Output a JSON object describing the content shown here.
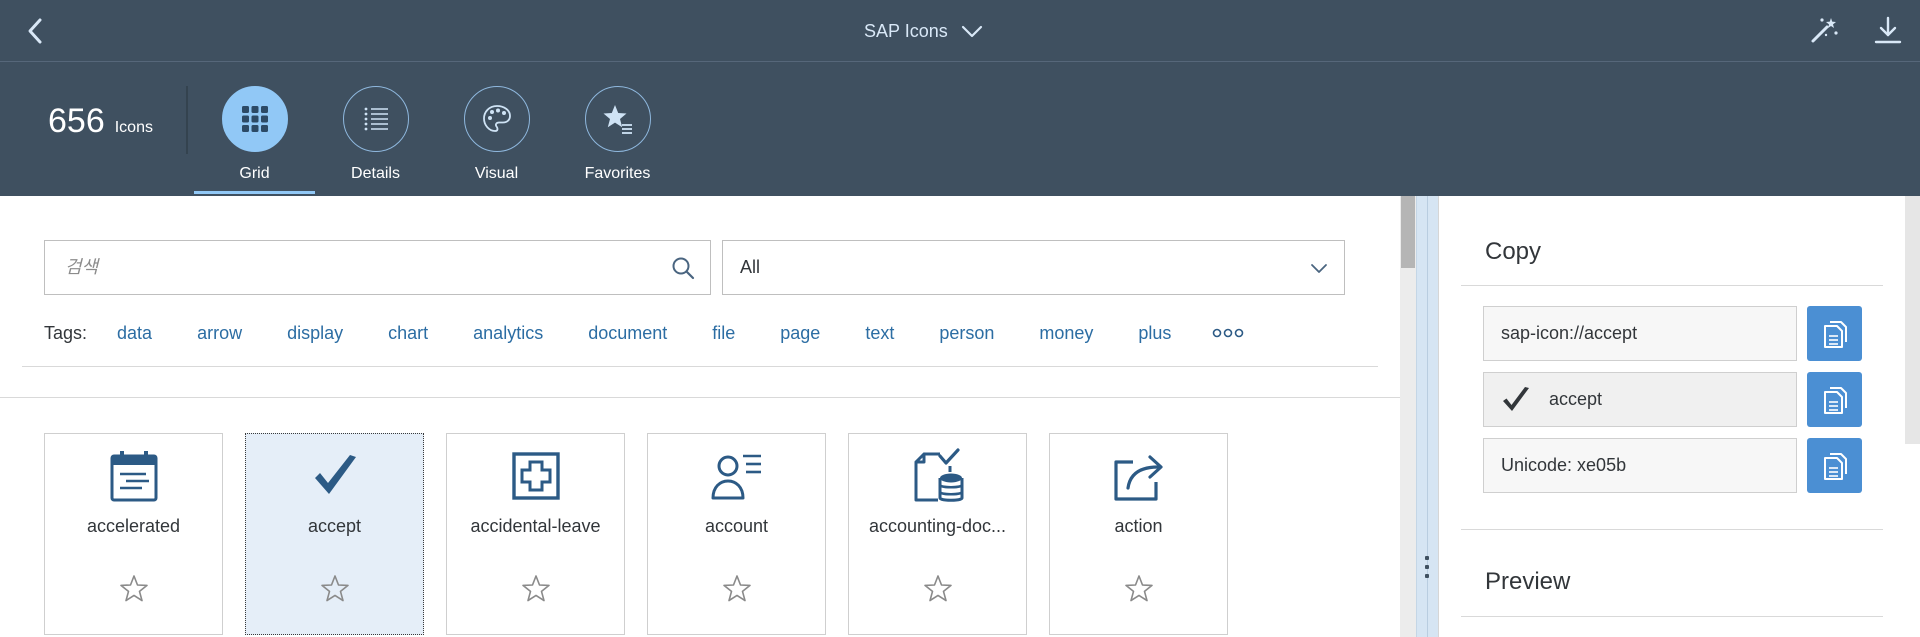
{
  "shell": {
    "title": "SAP Icons",
    "icons": {
      "back": "back-arrow-icon",
      "title_menu": "chevron-down-icon",
      "magic": "magic-wand-icon",
      "download": "download-icon"
    }
  },
  "header": {
    "count_value": "656",
    "count_label": "Icons",
    "tabs": [
      {
        "label": "Grid",
        "icon": "grid-icon",
        "active": true
      },
      {
        "label": "Details",
        "icon": "list-icon",
        "active": false
      },
      {
        "label": "Visual",
        "icon": "palette-icon",
        "active": false
      },
      {
        "label": "Favorites",
        "icon": "favorite-list-icon",
        "active": false
      }
    ]
  },
  "search": {
    "placeholder": "검색",
    "value": ""
  },
  "filter": {
    "selected": "All"
  },
  "tags": {
    "label": "Tags:",
    "items": [
      "data",
      "arrow",
      "display",
      "chart",
      "analytics",
      "document",
      "file",
      "page",
      "text",
      "person",
      "money",
      "plus"
    ]
  },
  "icons_list": [
    {
      "name": "accelerated",
      "icon": "calendar-accelerated-icon",
      "selected": false
    },
    {
      "name": "accept",
      "icon": "checkmark-icon",
      "selected": true
    },
    {
      "name": "accidental-leave",
      "icon": "medical-cross-icon",
      "selected": false
    },
    {
      "name": "account",
      "icon": "person-account-icon",
      "selected": false
    },
    {
      "name": "accounting-doc...",
      "icon": "accounting-document-icon",
      "selected": false
    },
    {
      "name": "action",
      "icon": "share-action-icon",
      "selected": false
    }
  ],
  "side": {
    "copy_title": "Copy",
    "copy_fields": {
      "uri": "sap-icon://accept",
      "glyph_name": "accept",
      "unicode": "Unicode: xe05b"
    },
    "preview_title": "Preview"
  },
  "colors": {
    "shell_bg": "#3f5060",
    "accent": "#91c8f6",
    "icon_blue": "#2c5a85",
    "link": "#2c6da3",
    "copy_button": "#4b8fd3",
    "selected_card": "#e5eef8"
  }
}
